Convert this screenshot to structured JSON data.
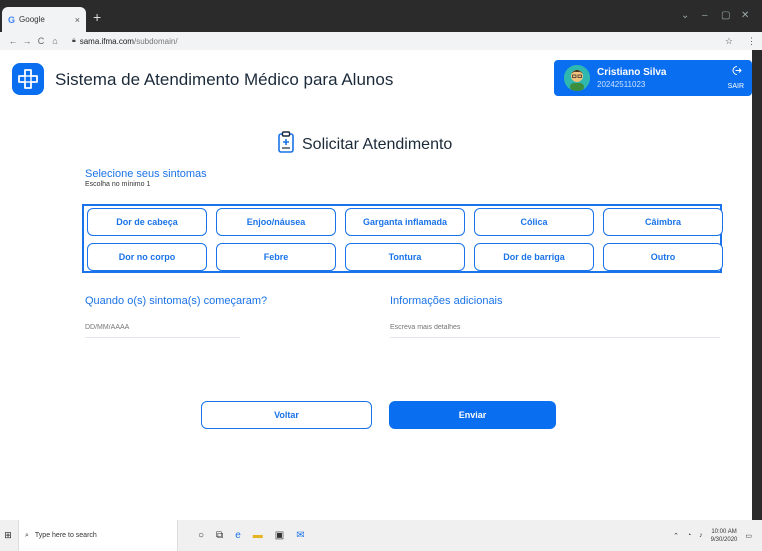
{
  "browser": {
    "tab_title": "Google",
    "tab_close": "×",
    "new_tab": "+",
    "url_host": "sama.ifma.com",
    "url_path": "/subdomain/",
    "window_controls": [
      "⌄",
      "–",
      "▢",
      "✕"
    ]
  },
  "header": {
    "app_title": "Sistema de Atendimento Médico para Alunos"
  },
  "user": {
    "name": "Cristiano Silva",
    "id": "20242511023",
    "logout_label": "SAIR"
  },
  "form": {
    "title": "Solicitar Atendimento",
    "symptoms_heading": "Selecione seus sintomas",
    "symptoms_sub": "Escolha no mínimo 1",
    "symptoms": [
      "Dor de cabeça",
      "Enjoo/náusea",
      "Garganta inflamada",
      "Cólica",
      "Câimbra",
      "Dor no corpo",
      "Febre",
      "Tontura",
      "Dor de barriga",
      "Outro"
    ],
    "when_label": "Quando o(s) sintoma(s) começaram?",
    "when_placeholder": "DD/MM/AAAA",
    "info_label": "Informações adicionais",
    "info_placeholder": "Escreva mais detalhes",
    "back_label": "Voltar",
    "send_label": "Enviar"
  },
  "taskbar": {
    "search_placeholder": "Type here to search",
    "time": "10:00 AM",
    "date": "9/30/2020"
  },
  "colors": {
    "primary": "#0a6ef0",
    "accent_text": "#1a73e8"
  }
}
